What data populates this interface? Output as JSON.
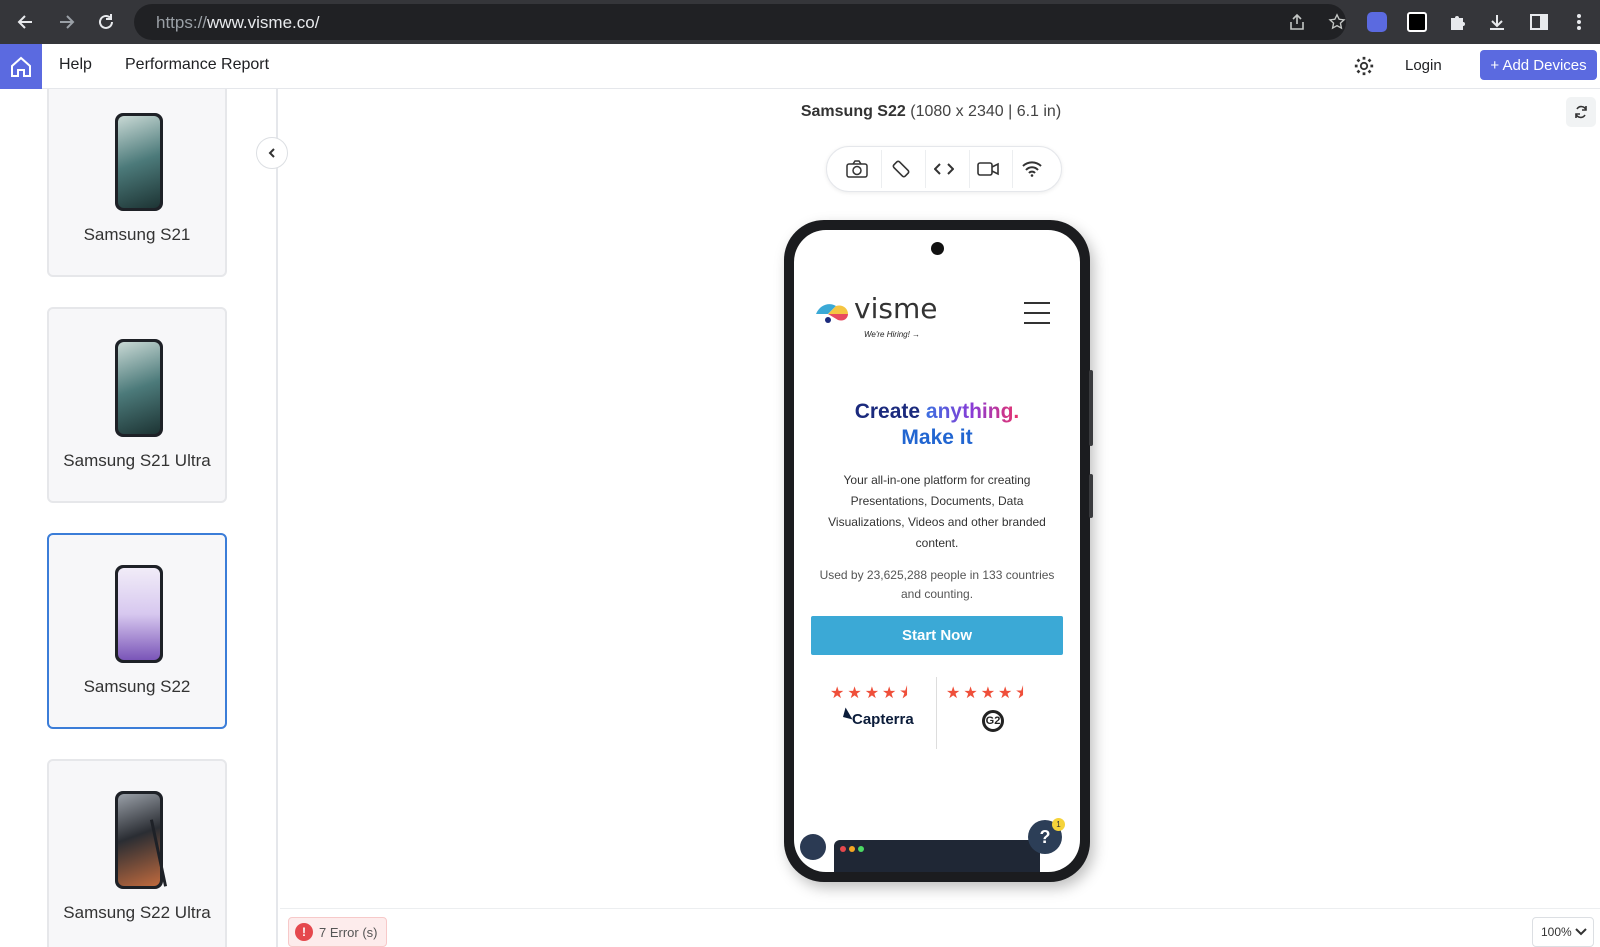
{
  "browser": {
    "url_scheme": "https://",
    "url_host": "www.visme.co/"
  },
  "appbar": {
    "help": "Help",
    "performance_report": "Performance Report",
    "login": "Login",
    "add_devices": "+ Add Devices"
  },
  "devices": [
    {
      "name": "Samsung S21",
      "selected": false,
      "screen_color": "#5e8e8c"
    },
    {
      "name": "Samsung S21 Ultra",
      "selected": false,
      "screen_color": "#5e8e8c"
    },
    {
      "name": "Samsung S22",
      "selected": true,
      "screen_color": "#9b82cf"
    },
    {
      "name": "Samsung S22 Ultra",
      "selected": false,
      "screen_color": "#c06a3e"
    }
  ],
  "preview": {
    "device_name": "Samsung S22",
    "device_specs": "(1080 x 2340 | 6.1 in)"
  },
  "site": {
    "logo_word": "visme",
    "hiring": "We're Hiring! →",
    "hero_line1_a": "Create ",
    "hero_line1_b": "anything.",
    "hero_line2": "Make it",
    "description": "Your all-in-one platform for creating Presentations, Documents, Data Visualizations, Videos and other branded content.",
    "used_by": "Used by 23,625,288 people in 133 countries and counting.",
    "cta": "Start Now",
    "capterra_stars": "★★★★⯨",
    "g2_stars": "★★★★⯨",
    "capterra_label": "Capterra",
    "g2_label": "G2",
    "help_bubble": "?",
    "notification_count": "1"
  },
  "footer": {
    "errors": "7 Error (s)",
    "zoom": "100%"
  },
  "colors": {
    "accent": "#5b6ae0",
    "selected_border": "#3b7dd8",
    "cta": "#3ba9d6"
  }
}
